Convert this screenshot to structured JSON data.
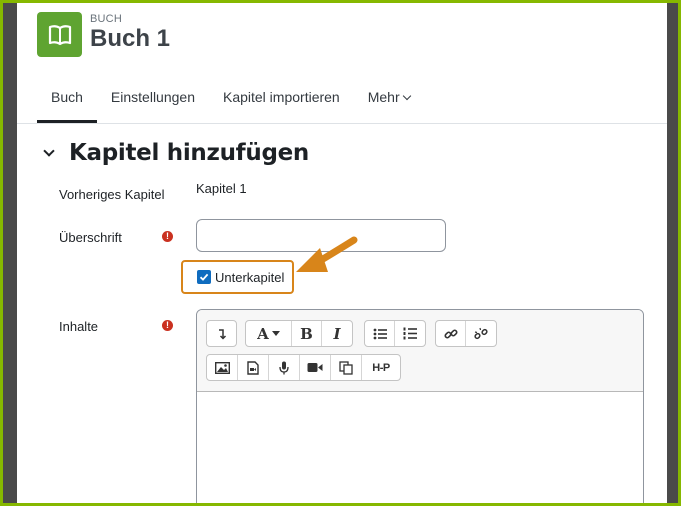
{
  "header": {
    "kicker": "BUCH",
    "title": "Buch 1",
    "icon": "book-icon",
    "icon_color": "#5fa431"
  },
  "tabs": [
    {
      "label": "Buch",
      "active": true
    },
    {
      "label": "Einstellungen",
      "active": false
    },
    {
      "label": "Kapitel importieren",
      "active": false
    },
    {
      "label": "Mehr",
      "active": false
    }
  ],
  "section": {
    "title": "Kapitel hinzufügen"
  },
  "form": {
    "previous_chapter_label": "Vorheriges Kapitel",
    "previous_chapter_value": "Kapitel 1",
    "heading_label": "Überschrift",
    "heading_value": "",
    "subchapter_label": "Unterkapitel",
    "subchapter_checked": true,
    "content_label": "Inhalte"
  },
  "editor_toolbar": {
    "row1": [
      "collapse-icon",
      "font-size-icon",
      "bold-icon",
      "italic-icon",
      "unordered-list-icon",
      "ordered-list-icon",
      "link-icon",
      "unlink-icon"
    ],
    "row2": [
      "image-icon",
      "media-icon",
      "microphone-icon",
      "video-icon",
      "copy-icon",
      "h5p-icon"
    ],
    "font_label": "A",
    "bold_label": "B",
    "italic_label": "I",
    "h5p_label": "H-P"
  },
  "colors": {
    "frame_border": "#86b800",
    "highlight": "#d8851a",
    "required": "#ca3120",
    "checkbox": "#0f6cbf"
  }
}
